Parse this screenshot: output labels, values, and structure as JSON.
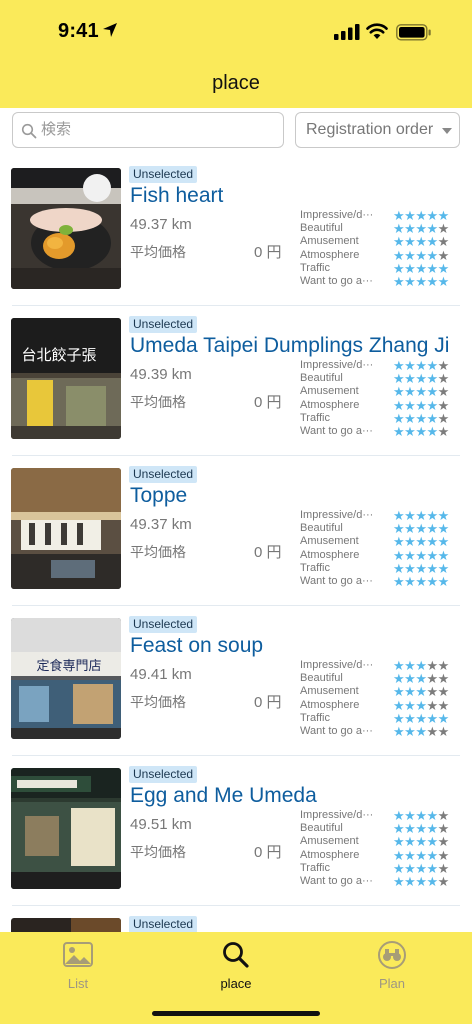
{
  "status": {
    "time": "9:41"
  },
  "nav": {
    "title": "place"
  },
  "search": {
    "placeholder": "検索",
    "sort_label": "Registration order"
  },
  "rating_labels": [
    "Impressive/d···",
    "Beautiful",
    "Amusement",
    "Atmosphere",
    "Traffic",
    "Want to go a···"
  ],
  "colors": {
    "header": "#faea5a",
    "accent": "#0e5d9e",
    "star_on": "#56b8ea",
    "star_off": "#7c7c7c"
  },
  "places": [
    {
      "status": "Unselected",
      "name": "Fish heart",
      "distance": "49.37 km",
      "price_label": "平均価格",
      "price": "0 円",
      "ratings": [
        5,
        4,
        4,
        4,
        5,
        5
      ],
      "photo": "sushi"
    },
    {
      "status": "Unselected",
      "name": "Umeda Taipei Dumplings Zhang Ji",
      "distance": "49.39 km",
      "price_label": "平均価格",
      "price": "0 円",
      "ratings": [
        4,
        4,
        4,
        4,
        4,
        4
      ],
      "photo": "storefront-sign",
      "photo_text": "台北餃子張"
    },
    {
      "status": "Unselected",
      "name": "Toppe",
      "distance": "49.37 km",
      "price_label": "平均価格",
      "price": "0 円",
      "ratings": [
        5,
        5,
        5,
        5,
        5,
        5
      ],
      "photo": "interior"
    },
    {
      "status": "Unselected",
      "name": "Feast on soup",
      "distance": "49.41 km",
      "price_label": "平均価格",
      "price": "0 円",
      "ratings": [
        3,
        3,
        3,
        3,
        5,
        3
      ],
      "photo": "shop-front",
      "photo_text": "定食専門店"
    },
    {
      "status": "Unselected",
      "name": "Egg and Me Umeda",
      "distance": "49.51 km",
      "price_label": "平均価格",
      "price": "0 円",
      "ratings": [
        4,
        4,
        4,
        4,
        4,
        4
      ],
      "photo": "storefront-dark"
    },
    {
      "status": "Unselected",
      "name": "",
      "distance": "",
      "price_label": "",
      "price": "",
      "ratings": [],
      "photo": "partial"
    }
  ],
  "tabs": [
    {
      "label": "List",
      "icon": "image-icon",
      "active": false
    },
    {
      "label": "place",
      "icon": "search-icon",
      "active": true
    },
    {
      "label": "Plan",
      "icon": "binoculars-icon",
      "active": false
    }
  ]
}
